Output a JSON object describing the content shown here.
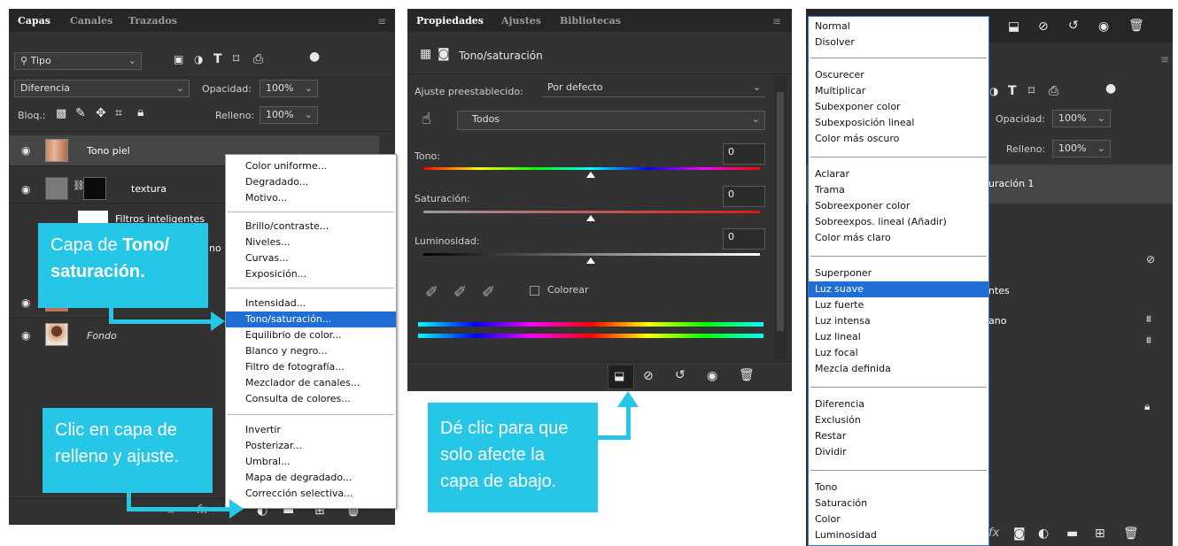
{
  "layers_panel": {
    "tabs": [
      "Capas",
      "Canales",
      "Trazados"
    ],
    "filter_label": "Tipo",
    "blend_mode": "Diferencia",
    "opacity_label": "Opacidad:",
    "opacity_value": "100%",
    "lock_label": "Bloq.:",
    "fill_label": "Relleno:",
    "fill_value": "100%",
    "layers": [
      {
        "name": "Tono piel"
      },
      {
        "name": "textura"
      },
      {
        "name": "Filtros inteligentes"
      },
      {
        "name": "no"
      },
      {
        "name": "Fondo"
      }
    ]
  },
  "adjust_menu": {
    "groups": [
      [
        "Color uniforme...",
        "Degradado...",
        "Motivo..."
      ],
      [
        "Brillo/contraste...",
        "Niveles...",
        "Curvas...",
        "Exposición..."
      ],
      [
        "Intensidad...",
        "Tono/saturación...",
        "Equilibrio de color...",
        "Blanco y negro...",
        "Filtro de fotografía...",
        "Mezclador de canales...",
        "Consulta de colores..."
      ],
      [
        "Invertir",
        "Posterizar...",
        "Umbral...",
        "Mapa de degradado...",
        "Corrección selectiva..."
      ]
    ],
    "selected": "Tono/saturación..."
  },
  "callouts": {
    "tono_pre": "Capa de ",
    "tono_bold": "Tono/ saturación.",
    "relleno": "Clic en capa de relleno y ajuste.",
    "clip": "Dé clic para que solo afecte la capa de abajo."
  },
  "properties_panel": {
    "tabs": [
      "Propiedades",
      "Ajustes",
      "Bibliotecas"
    ],
    "title": "Tono/saturación",
    "preset_label": "Ajuste preestablecido:",
    "preset_value": "Por defecto",
    "channel_value": "Todos",
    "hue_label": "Tono:",
    "hue_value": "0",
    "saturation_label": "Saturación:",
    "saturation_value": "0",
    "lightness_label": "Luminosidad:",
    "lightness_value": "0",
    "colorize_label": "Colorear"
  },
  "blend_panel": {
    "groups": [
      [
        "Normal",
        "Disolver"
      ],
      [
        "Oscurecer",
        "Multiplicar",
        "Subexponer color",
        "Subexposición lineal",
        "Color más oscuro"
      ],
      [
        "Aclarar",
        "Trama",
        "Sobreexponer color",
        "Sobreexpos. lineal (Añadir)",
        "Color más claro"
      ],
      [
        "Superponer",
        "Luz suave",
        "Luz fuerte",
        "Luz intensa",
        "Luz lineal",
        "Luz focal",
        "Mezcla definida"
      ],
      [
        "Diferencia",
        "Exclusión",
        "Restar",
        "Dividir"
      ],
      [
        "Tono",
        "Saturación",
        "Color",
        "Luminosidad"
      ]
    ],
    "selected": "Luz suave",
    "bg_opacity_label": "Opacidad:",
    "bg_opacity_value": "100%",
    "bg_fill_label": "Relleno:",
    "bg_fill_value": "100%",
    "bg_layer_name": "uración 1",
    "bg_text_1": "ntes",
    "bg_text_2": "ano"
  }
}
